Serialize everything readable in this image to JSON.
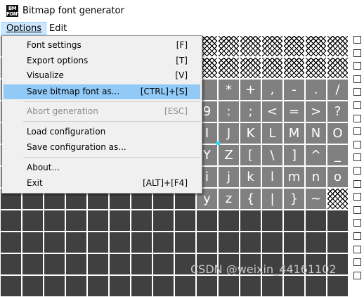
{
  "window": {
    "icon_text": "BM\nFONT",
    "title": "Bitmap font generator"
  },
  "menubar": {
    "options_label": "Options",
    "edit_label": "Edit"
  },
  "options_menu": [
    {
      "label": "Font settings",
      "shortcut": "[F]",
      "state": "normal"
    },
    {
      "label": "Export options",
      "shortcut": "[T]",
      "state": "normal"
    },
    {
      "label": "Visualize",
      "shortcut": "[V]",
      "state": "normal"
    },
    {
      "label": "Save bitmap font as...",
      "shortcut": "[CTRL]+[S]",
      "state": "highlighted"
    },
    {
      "label": "Abort generation",
      "shortcut": "[ESC]",
      "state": "disabled"
    },
    {
      "label": "Load configuration",
      "shortcut": "",
      "state": "normal"
    },
    {
      "label": "Save configuration as...",
      "shortcut": "",
      "state": "normal"
    },
    {
      "label": "About...",
      "shortcut": "",
      "state": "normal"
    },
    {
      "label": "Exit",
      "shortcut": "[ALT]+[F4]",
      "state": "normal"
    }
  ],
  "character_grid": {
    "columns": 16,
    "rows": [
      [
        "",
        "",
        "",
        "",
        "",
        "",
        "",
        "",
        "",
        "",
        "",
        "",
        "",
        "",
        "",
        ""
      ],
      [
        "",
        "",
        "",
        "",
        "",
        "",
        "",
        "",
        "",
        "",
        "",
        "",
        "",
        "",
        "",
        ""
      ],
      [
        "",
        "",
        "",
        "",
        "",
        "",
        "",
        "",
        "",
        "",
        "*",
        "+",
        ",",
        "-",
        ".",
        "/"
      ],
      [
        "",
        "",
        "",
        "",
        "",
        "",
        "",
        "",
        "",
        "9",
        ":",
        ";",
        "<",
        "=",
        ">",
        "?"
      ],
      [
        "",
        "",
        "",
        "",
        "",
        "",
        "",
        "",
        "",
        "I",
        "J",
        "K",
        "L",
        "M",
        "N",
        "O"
      ],
      [
        "",
        "",
        "",
        "",
        "",
        "",
        "",
        "",
        "",
        "Y",
        "Z",
        "[",
        "\\",
        "]",
        "^",
        "_"
      ],
      [
        "",
        "",
        "",
        "",
        "",
        "",
        "",
        "",
        "",
        "i",
        "j",
        "k",
        "l",
        "m",
        "n",
        "o"
      ],
      [
        "",
        "",
        "",
        "",
        "",
        "",
        "",
        "",
        "",
        "y",
        "z",
        "{",
        "|",
        "}",
        "~",
        ""
      ],
      [
        "",
        "",
        "",
        "",
        "",
        "",
        "",
        "",
        "",
        "",
        "",
        "",
        "",
        "",
        "",
        ""
      ],
      [
        "",
        "",
        "",
        "",
        "",
        "",
        "",
        "",
        "",
        "",
        "",
        "",
        "",
        "",
        "",
        ""
      ],
      [
        "",
        "",
        "",
        "",
        "",
        "",
        "",
        "",
        "",
        "",
        "",
        "",
        "",
        "",
        "",
        ""
      ],
      [
        "",
        "",
        "",
        "",
        "",
        "",
        "",
        "",
        "",
        "",
        "",
        "",
        "",
        "",
        "",
        ""
      ]
    ],
    "cell_types": [
      [
        "e",
        "e",
        "e",
        "e",
        "e",
        "e",
        "e",
        "e",
        "e",
        "h",
        "h",
        "h",
        "h",
        "h",
        "h",
        "h"
      ],
      [
        "e",
        "e",
        "e",
        "e",
        "e",
        "e",
        "e",
        "e",
        "e",
        "h",
        "h",
        "h",
        "h",
        "h",
        "h",
        "h"
      ],
      [
        "e",
        "e",
        "e",
        "e",
        "e",
        "e",
        "e",
        "e",
        "e",
        "g",
        "g",
        "g",
        "g",
        "g",
        "g",
        "g"
      ],
      [
        "e",
        "e",
        "e",
        "e",
        "e",
        "e",
        "e",
        "e",
        "e",
        "g",
        "g",
        "g",
        "g",
        "g",
        "g",
        "g"
      ],
      [
        "e",
        "e",
        "e",
        "e",
        "e",
        "e",
        "e",
        "e",
        "e",
        "g",
        "g",
        "g",
        "g",
        "g",
        "g",
        "g"
      ],
      [
        "e",
        "e",
        "e",
        "e",
        "e",
        "e",
        "e",
        "e",
        "e",
        "g",
        "g",
        "g",
        "g",
        "g",
        "g",
        "g"
      ],
      [
        "e",
        "e",
        "e",
        "e",
        "e",
        "e",
        "e",
        "e",
        "e",
        "g",
        "g",
        "g",
        "g",
        "g",
        "g",
        "g"
      ],
      [
        "e",
        "e",
        "e",
        "e",
        "e",
        "e",
        "e",
        "e",
        "e",
        "g",
        "g",
        "g",
        "g",
        "g",
        "g",
        "h"
      ],
      [
        "e",
        "e",
        "e",
        "e",
        "e",
        "e",
        "e",
        "e",
        "e",
        "e",
        "e",
        "e",
        "e",
        "e",
        "e",
        "e"
      ],
      [
        "e",
        "e",
        "e",
        "e",
        "e",
        "e",
        "e",
        "e",
        "e",
        "e",
        "e",
        "e",
        "e",
        "e",
        "e",
        "e"
      ],
      [
        "e",
        "e",
        "e",
        "e",
        "e",
        "e",
        "e",
        "e",
        "e",
        "e",
        "e",
        "e",
        "e",
        "e",
        "e",
        "e"
      ],
      [
        "e",
        "e",
        "e",
        "e",
        "e",
        "e",
        "e",
        "e",
        "e",
        "e",
        "e",
        "e",
        "e",
        "e",
        "e",
        "e"
      ]
    ]
  },
  "range_checkboxes": 19,
  "watermark": "CSDN @weixin_44161102",
  "colors": {
    "highlight": "#91c9f7",
    "menu_bg": "#f0f0f0",
    "empty_cell": "#404040",
    "glyph_cell": "#808080",
    "cursor": "#22ddff"
  }
}
